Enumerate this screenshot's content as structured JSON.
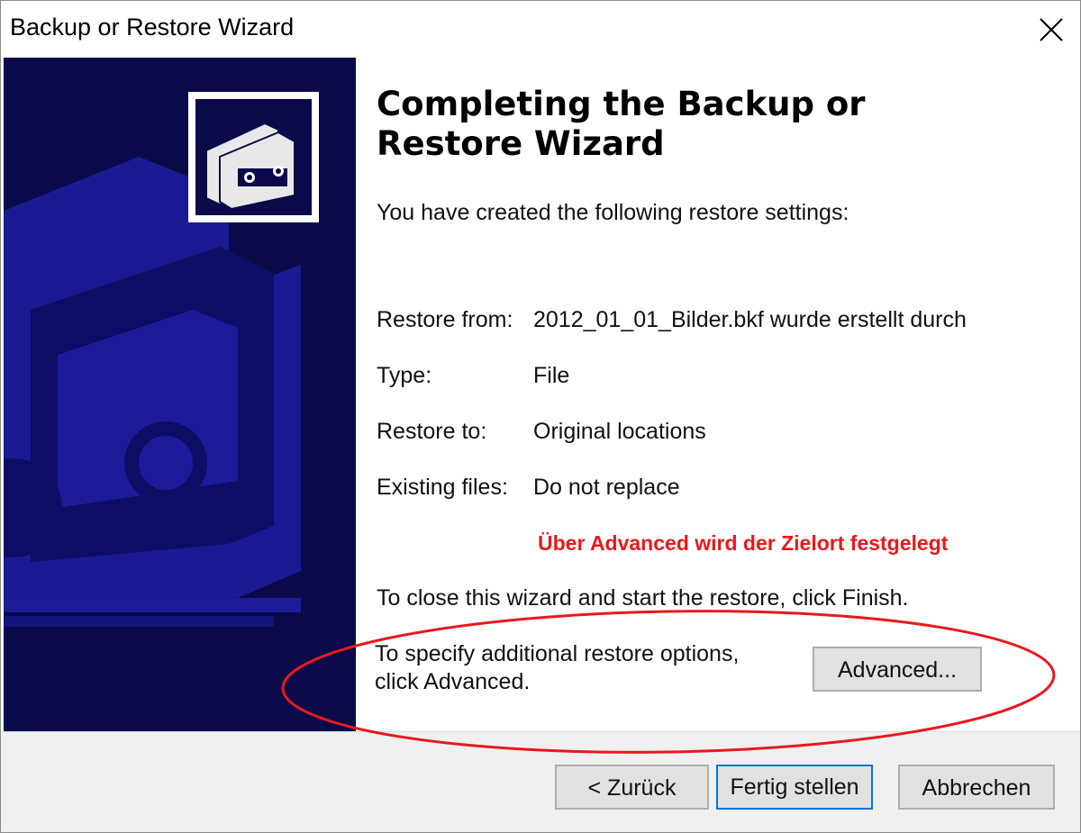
{
  "window": {
    "title": "Backup or Restore Wizard"
  },
  "main": {
    "heading": "Completing the Backup or Restore Wizard",
    "intro": "You have created the following restore settings:",
    "settings": [
      {
        "label": "Restore from:",
        "value": "2012_01_01_Bilder.bkf wurde erstellt durch"
      },
      {
        "label": "Type:",
        "value": "File"
      },
      {
        "label": "Restore to:",
        "value": "Original locations"
      },
      {
        "label": "Existing files:",
        "value": "Do not replace"
      }
    ],
    "annotation": "Über Advanced wird der Zielort festgelegt",
    "finish_hint": "To close this wizard and start the restore, click Finish.",
    "advanced_hint": "To specify additional restore options, click Advanced.",
    "advanced_button": "Advanced..."
  },
  "footer": {
    "back_button": "< Zurück",
    "finish_button": "Fertig stellen",
    "cancel_button": "Abbrechen"
  },
  "colors": {
    "side_panel": "#0a0a4a",
    "annotation": "#e8191c",
    "focus_border": "#0078d7"
  },
  "icons": {
    "close": "close-icon",
    "wizard": "backup-tape-icon"
  }
}
